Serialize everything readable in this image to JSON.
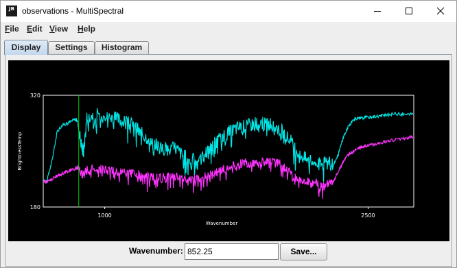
{
  "window": {
    "app_icon_text": [
      "JB"
    ],
    "title": "observations - MultiSpectral"
  },
  "menu": {
    "items": [
      {
        "label": "File"
      },
      {
        "label": "Edit"
      },
      {
        "label": "View"
      },
      {
        "label": "Help"
      }
    ]
  },
  "tabs": [
    {
      "label": "Display",
      "active": true
    },
    {
      "label": "Settings",
      "active": false
    },
    {
      "label": "Histogram",
      "active": false
    }
  ],
  "chart_data": {
    "type": "line",
    "xlabel": "Wavenumber",
    "ylabel": "BrightnessTemp",
    "xlim": [
      650,
      2760
    ],
    "ylim": [
      180,
      320
    ],
    "x_ticks": [
      1000,
      2500
    ],
    "y_ticks": [
      180,
      320
    ],
    "background": "#000000",
    "frame_color": "#ffffff",
    "marker_wavenumber": 852.25,
    "marker_color": "#00cc00",
    "series": [
      {
        "color": "#00e5e5",
        "x": [
          655,
          670,
          700,
          730,
          760,
          790,
          830,
          845,
          870,
          880,
          900,
          950,
          1000,
          1040,
          1080,
          1120,
          1160,
          1200,
          1240,
          1280,
          1320,
          1360,
          1400,
          1440,
          1480,
          1520,
          1560,
          1600,
          1640,
          1680,
          1720,
          1760,
          1800,
          1840,
          1880,
          1920,
          1960,
          2000,
          2040,
          2080,
          2120,
          2160,
          2200,
          2240,
          2270,
          2300,
          2330,
          2360,
          2390,
          2420,
          2450,
          2480,
          2520,
          2560,
          2600,
          2650,
          2700,
          2755
        ],
        "y": [
          213,
          212,
          238,
          275,
          283,
          285,
          290,
          288,
          255,
          250,
          295,
          296,
          295,
          292,
          290,
          286,
          284,
          274,
          268,
          263,
          253,
          252,
          255,
          246,
          240,
          240,
          246,
          253,
          262,
          270,
          276,
          280,
          282,
          284,
          285,
          284,
          282,
          278,
          268,
          256,
          245,
          238,
          236,
          233,
          235,
          232,
          246,
          268,
          282,
          290,
          291,
          292,
          293,
          294,
          295,
          297,
          296,
          296
        ]
      },
      {
        "color": "#ff33ff",
        "x": [
          655,
          670,
          700,
          730,
          760,
          790,
          830,
          845,
          870,
          880,
          900,
          950,
          1000,
          1040,
          1080,
          1120,
          1160,
          1200,
          1240,
          1280,
          1320,
          1360,
          1400,
          1440,
          1480,
          1520,
          1560,
          1600,
          1640,
          1680,
          1720,
          1760,
          1800,
          1840,
          1880,
          1920,
          1960,
          2000,
          2040,
          2080,
          2120,
          2160,
          2200,
          2240,
          2270,
          2300,
          2330,
          2360,
          2390,
          2420,
          2450,
          2480,
          2520,
          2560,
          2600,
          2650,
          2700,
          2755
        ],
        "y": [
          212,
          211,
          215,
          219,
          222,
          225,
          228,
          229,
          222,
          220,
          227,
          228,
          228,
          226,
          225,
          223,
          222,
          220,
          218,
          217,
          216,
          218,
          218,
          216,
          214,
          215,
          217,
          220,
          224,
          228,
          230,
          233,
          235,
          236,
          237,
          237,
          236,
          234,
          226,
          218,
          214,
          212,
          210,
          206,
          208,
          211,
          224,
          237,
          246,
          250,
          254,
          256,
          258,
          260,
          262,
          264,
          266,
          268
        ]
      }
    ]
  },
  "bottom": {
    "wavenumber_label": "Wavenumber:",
    "wavenumber_value": "852.25",
    "save_label": "Save..."
  }
}
